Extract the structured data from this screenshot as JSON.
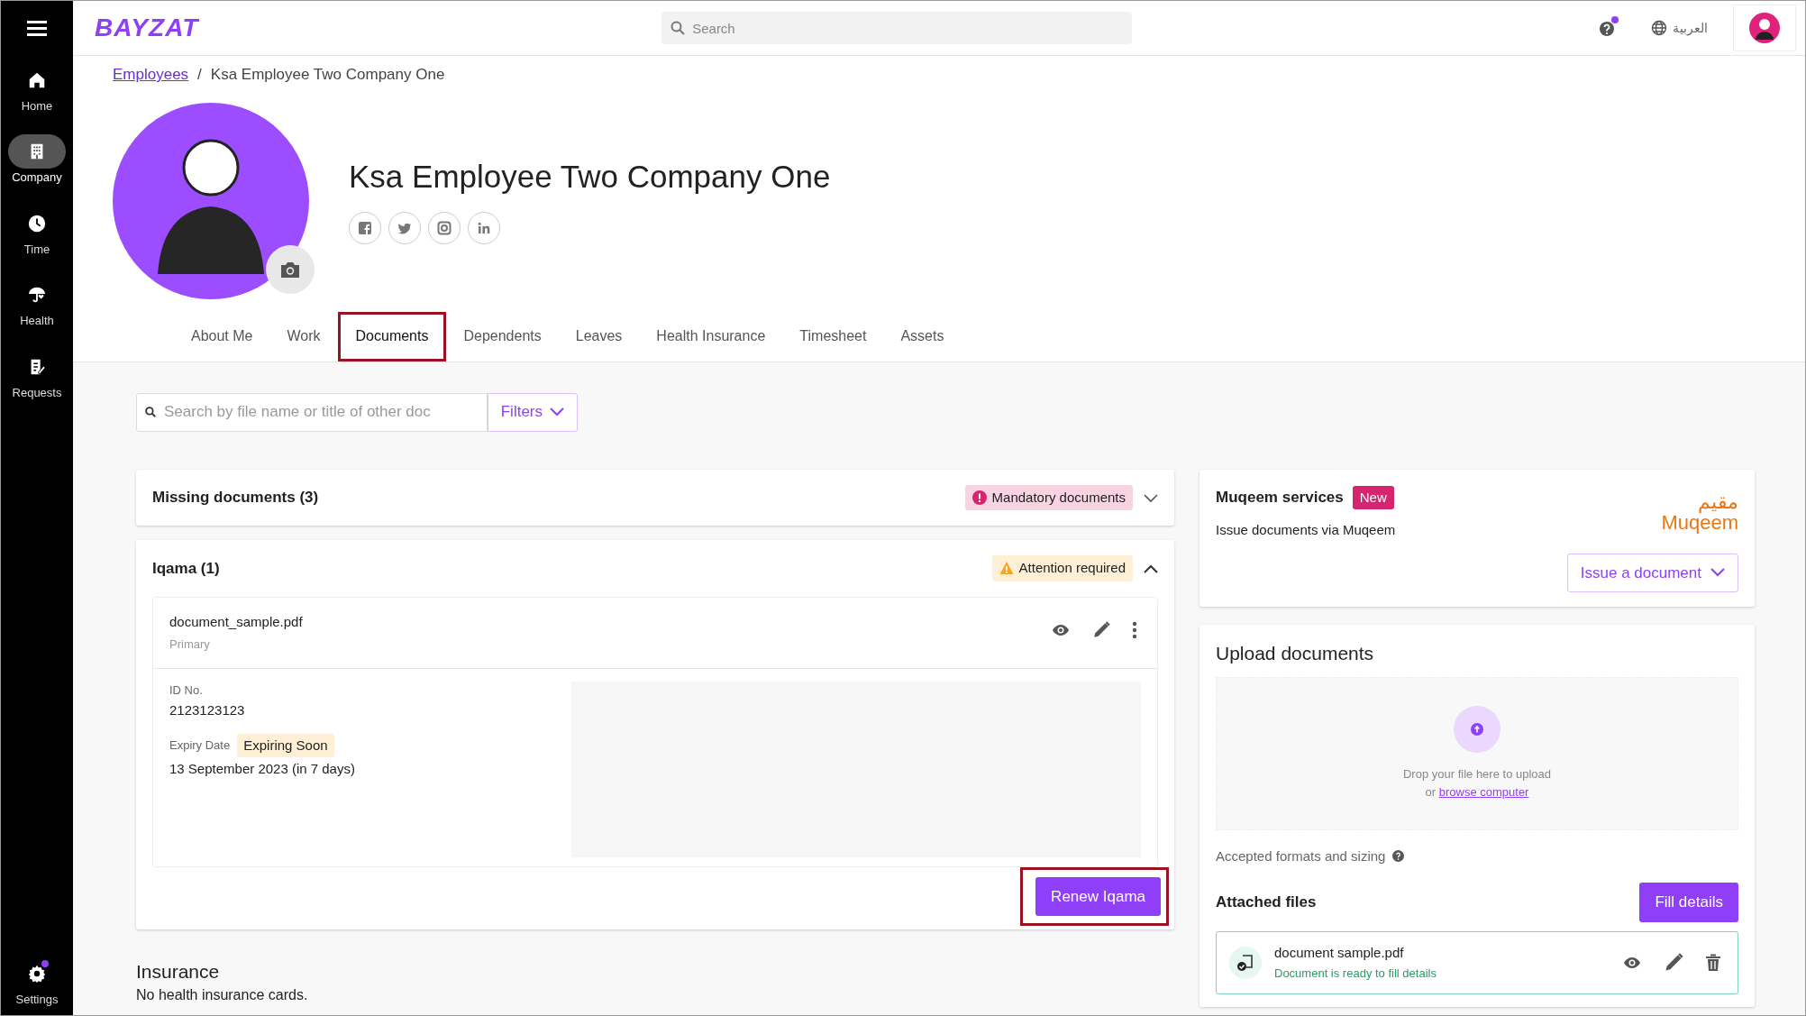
{
  "sidebar": {
    "items": [
      {
        "label": "Home",
        "selected": false
      },
      {
        "label": "Company",
        "selected": true
      },
      {
        "label": "Time",
        "selected": false
      },
      {
        "label": "Health",
        "selected": false
      },
      {
        "label": "Requests",
        "selected": false
      }
    ],
    "settings": {
      "label": "Settings",
      "notification": true
    }
  },
  "header": {
    "logo": "BAYZAT",
    "search": {
      "placeholder": "Search"
    },
    "help_notification": true,
    "language": "العربية"
  },
  "breadcrumb": {
    "items": [
      "Employees",
      "Ksa Employee Two Company One"
    ],
    "separator": "/"
  },
  "profile": {
    "name": "Ksa Employee Two Company One",
    "social": [
      {
        "kind": "facebook"
      },
      {
        "kind": "twitter"
      },
      {
        "kind": "instagram"
      },
      {
        "kind": "linkedin"
      }
    ]
  },
  "tabs": [
    {
      "label": "About Me",
      "selected": false
    },
    {
      "label": "Work",
      "selected": false
    },
    {
      "label": "Documents",
      "selected": true
    },
    {
      "label": "Dependents",
      "selected": false
    },
    {
      "label": "Leaves",
      "selected": false
    },
    {
      "label": "Health Insurance",
      "selected": false
    },
    {
      "label": "Timesheet",
      "selected": false
    },
    {
      "label": "Assets",
      "selected": false
    }
  ],
  "documents_search": {
    "placeholder": "Search by file name or title of other doc",
    "filters": "Filters"
  },
  "sections": [
    {
      "title": "Missing documents (3)",
      "badge": {
        "text": "Mandatory documents",
        "kind": "danger"
      },
      "expanded": false
    },
    {
      "title": "Iqama (1)",
      "badge": {
        "text": "Attention required",
        "kind": "warning"
      },
      "expanded": true,
      "document": {
        "file": "document_sample.pdf",
        "tag": "Primary",
        "fields": [
          {
            "label": "ID No.",
            "value": "2123123123"
          },
          {
            "label": "Expiry Date",
            "badge": "Expiring Soon",
            "value": "13 September 2023 (in 7 days)"
          }
        ]
      },
      "action": {
        "label": "Renew Iqama",
        "highlighted": true
      }
    }
  ],
  "insurance": {
    "title": "Insurance",
    "text": "No health insurance cards."
  },
  "muqeem": {
    "title": "Muqeem services",
    "badge": "New",
    "subtitle": "Issue documents via Muqeem",
    "logo_arabic": "مقيم",
    "logo_latin": "Muqeem",
    "button": "Issue a document"
  },
  "upload": {
    "title": "Upload documents",
    "drop_text": "Drop your file here to upload",
    "or": "or",
    "browse": "browse computer",
    "formats": "Accepted formats and sizing",
    "attached_title": "Attached files",
    "fill_button": "Fill details",
    "files": [
      {
        "name": "document sample.pdf",
        "status": "Document is ready to fill details"
      }
    ]
  }
}
